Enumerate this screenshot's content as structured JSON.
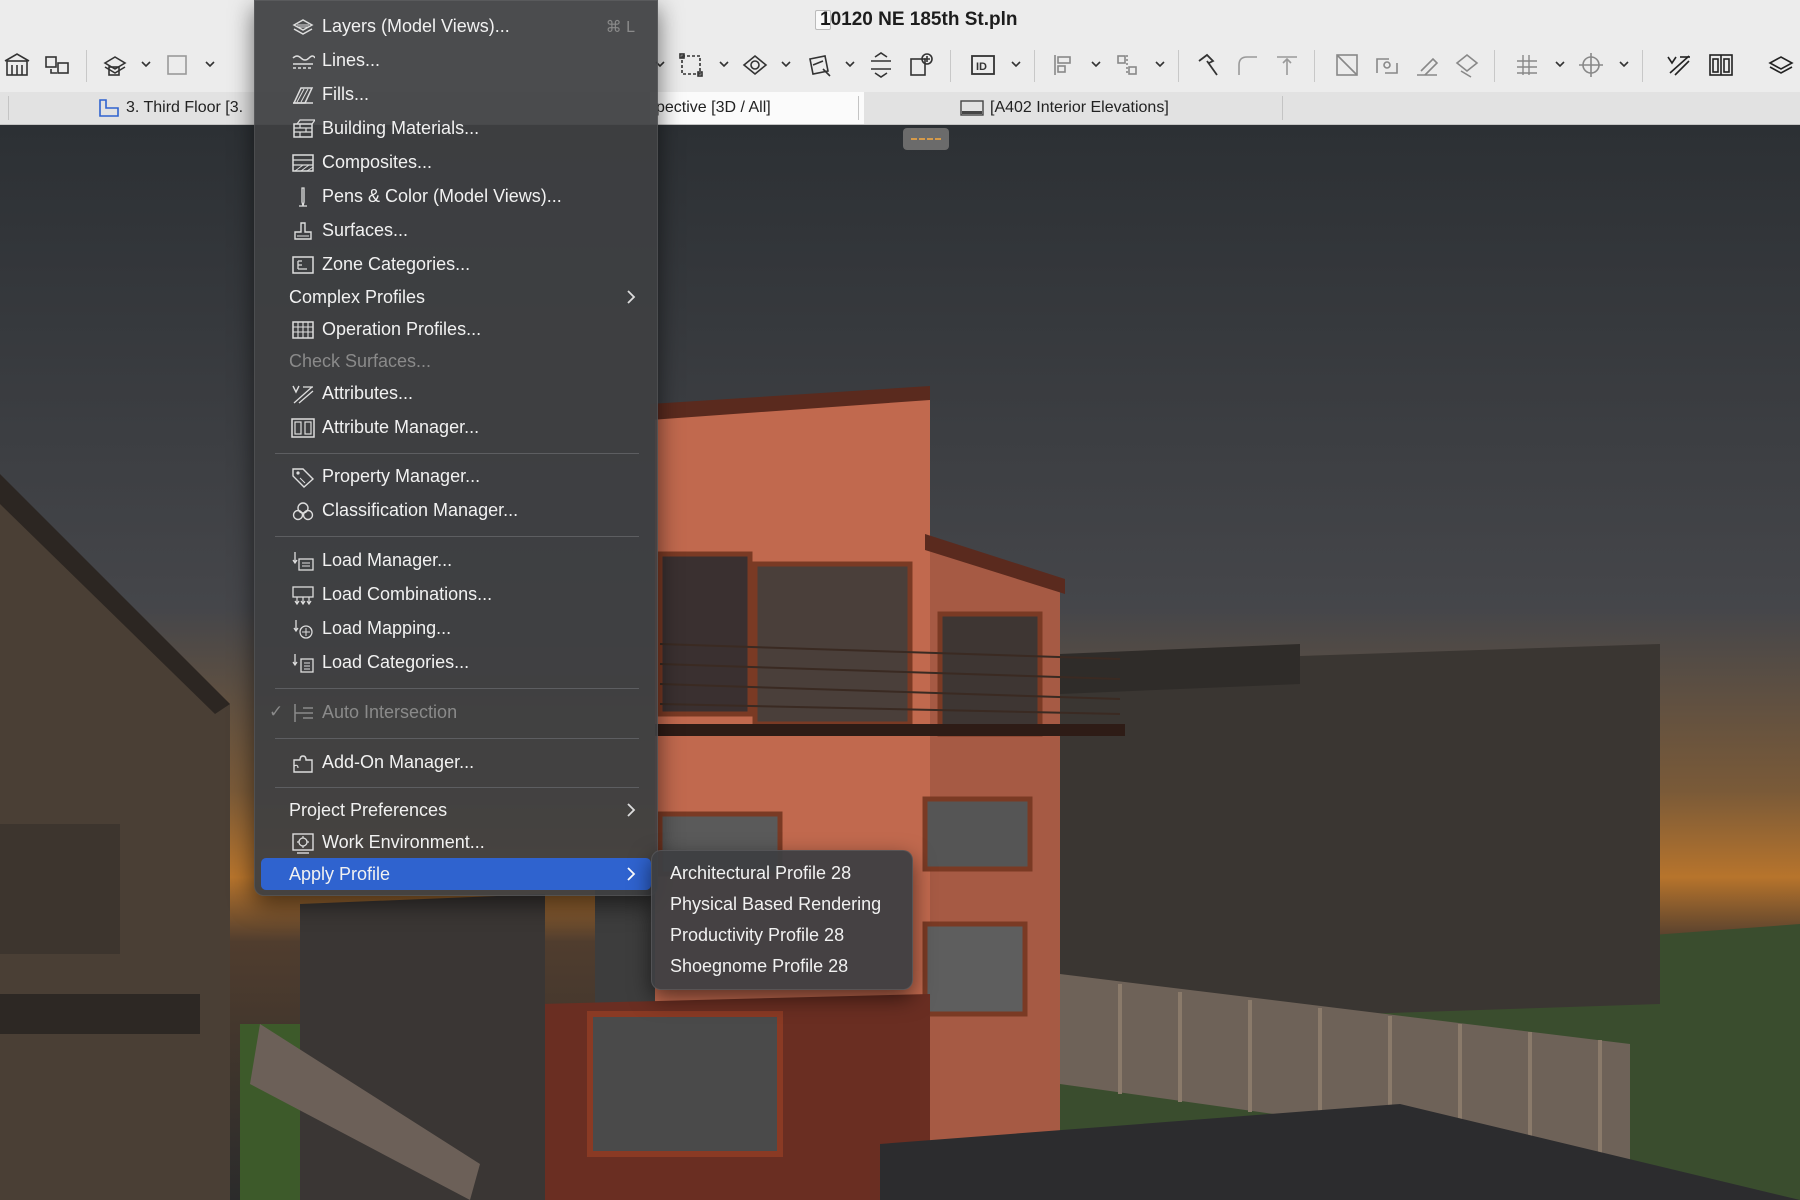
{
  "window": {
    "title": "10120 NE 185th St.pln"
  },
  "tabs": [
    {
      "label": "3. Third Floor [3.",
      "active": false
    },
    {
      "label": "pective [3D / All]",
      "active": true
    },
    {
      "label": "[A402 Interior Elevations]",
      "active": false
    }
  ],
  "menu": {
    "items": [
      {
        "label": "Layers (Model Views)...",
        "icon": "layers-icon",
        "shortcut": "⌘ L"
      },
      {
        "label": "Lines...",
        "icon": "lines-icon"
      },
      {
        "label": "Fills...",
        "icon": "fills-icon"
      },
      {
        "label": "Building Materials...",
        "icon": "building-materials-icon"
      },
      {
        "label": "Composites...",
        "icon": "composites-icon"
      },
      {
        "label": "Pens & Color (Model Views)...",
        "icon": "pen-icon"
      },
      {
        "label": "Surfaces...",
        "icon": "surfaces-icon"
      },
      {
        "label": "Zone Categories...",
        "icon": "zone-categories-icon"
      },
      {
        "label": "Complex Profiles",
        "submenu": true
      },
      {
        "label": "Operation Profiles...",
        "icon": "operation-profiles-icon"
      },
      {
        "label": "Check Surfaces...",
        "disabled": true
      },
      {
        "label": "Attributes...",
        "icon": "attributes-icon"
      },
      {
        "label": "Attribute Manager...",
        "icon": "attribute-manager-icon"
      },
      {
        "label": "Property Manager...",
        "icon": "tag-icon"
      },
      {
        "label": "Classification Manager...",
        "icon": "classification-icon"
      },
      {
        "label": "Load Manager...",
        "icon": "load-manager-icon"
      },
      {
        "label": "Load Combinations...",
        "icon": "load-combinations-icon"
      },
      {
        "label": "Load Mapping...",
        "icon": "load-mapping-icon"
      },
      {
        "label": "Load Categories...",
        "icon": "load-categories-icon"
      },
      {
        "label": "Auto Intersection",
        "icon": "intersection-icon",
        "disabled": true,
        "checked": true
      },
      {
        "label": "Add-On Manager...",
        "icon": "puzzle-icon"
      },
      {
        "label": "Project Preferences",
        "submenu": true
      },
      {
        "label": "Work Environment...",
        "icon": "work-environment-icon"
      },
      {
        "label": "Apply Profile",
        "submenu": true,
        "selected": true
      }
    ]
  },
  "submenu": {
    "items": [
      {
        "label": "Architectural Profile 28"
      },
      {
        "label": "Physical Based Rendering"
      },
      {
        "label": "Productivity Profile 28"
      },
      {
        "label": "Shoegnome Profile 28"
      }
    ]
  },
  "colors": {
    "selection": "#2f63cf",
    "menu_bg": "#3e3f42"
  }
}
